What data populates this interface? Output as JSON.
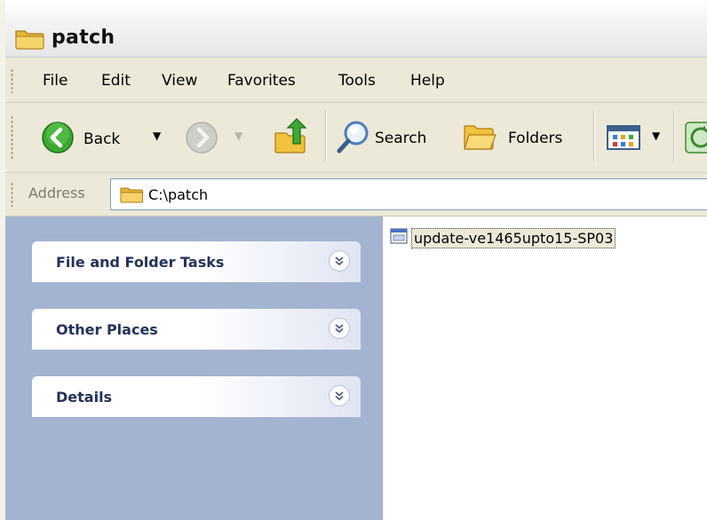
{
  "window": {
    "title": "patch"
  },
  "menu": {
    "items": [
      "File",
      "Edit",
      "View",
      "Favorites",
      "Tools",
      "Help"
    ]
  },
  "toolbar": {
    "back_label": "Back",
    "search_label": "Search",
    "folders_label": "Folders"
  },
  "address": {
    "label": "Address",
    "value": "C:\\patch"
  },
  "taskpane": {
    "panels": [
      {
        "title": "File and Folder Tasks"
      },
      {
        "title": "Other Places"
      },
      {
        "title": "Details"
      }
    ]
  },
  "files": [
    {
      "name": "update-ve1465upto15-SP03",
      "icon": "exe-file-icon",
      "selected": true
    }
  ],
  "colors": {
    "taskpane_bg": "#a4b4d0",
    "panel_title": "#23325b",
    "window_bg": "#ece9d8",
    "address_border": "#7f9db9"
  }
}
